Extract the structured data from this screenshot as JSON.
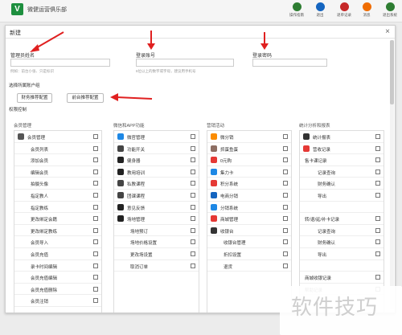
{
  "app": {
    "title": "微健运营俱乐部",
    "logo_text": "V"
  },
  "top_actions": [
    {
      "label": "操作指南",
      "color": "#2e7d32"
    },
    {
      "label": "退出",
      "color": "#1565c0"
    },
    {
      "label": "退单记录",
      "color": "#c62828"
    },
    {
      "label": "消息",
      "color": "#ef6c00"
    },
    {
      "label": "退出系统",
      "color": "#2e7d32"
    }
  ],
  "modal": {
    "title": "新建",
    "close_glyph": "×",
    "fields": {
      "name": {
        "label": "管理员姓名",
        "hint": "例如：前台小张、只是标识",
        "value": ""
      },
      "account": {
        "label": "登录账号",
        "hint": "6位以上的数字或字母，建议用手机号",
        "value": ""
      },
      "password": {
        "label": "登录密码",
        "value": ""
      }
    },
    "role_section_label": "选择所属账户组",
    "role_buttons": [
      "财务推荐配置",
      "前台推荐配置"
    ],
    "permission_label": "权限控制"
  },
  "columns": {
    "member": {
      "title": "会员管理",
      "rows": [
        {
          "label": "会员管理",
          "kind": "head",
          "icon": "#555"
        },
        {
          "label": "会员列表",
          "kind": "sub"
        },
        {
          "label": "添加会员",
          "kind": "sub"
        },
        {
          "label": "编辑会员",
          "kind": "sub"
        },
        {
          "label": "拍摄头像",
          "kind": "sub"
        },
        {
          "label": "指定教人",
          "kind": "sub"
        },
        {
          "label": "指定教练",
          "kind": "sub"
        },
        {
          "label": "更改绑定会籍",
          "kind": "sub"
        },
        {
          "label": "更改绑定教练",
          "kind": "sub"
        },
        {
          "label": "会员导入",
          "kind": "sub"
        },
        {
          "label": "会员充值",
          "kind": "sub"
        },
        {
          "label": "录卡时间编辑",
          "kind": "sub"
        },
        {
          "label": "会员充值编辑",
          "kind": "sub"
        },
        {
          "label": "会员充值删除",
          "kind": "sub"
        },
        {
          "label": "会员注销",
          "kind": "sub"
        }
      ]
    },
    "wechat": {
      "title": "微信和APP功能",
      "rows": [
        {
          "label": "微官管理",
          "kind": "head",
          "icon": "#1e88e5"
        },
        {
          "label": "功能开关",
          "kind": "head",
          "icon": "#444"
        },
        {
          "label": "健身器",
          "kind": "head",
          "icon": "#222"
        },
        {
          "label": "教用培训",
          "kind": "head",
          "icon": "#222"
        },
        {
          "label": "私教课程",
          "kind": "head",
          "icon": "#444"
        },
        {
          "label": "团课课程",
          "kind": "head",
          "icon": "#444"
        },
        {
          "label": "意见反馈",
          "kind": "head",
          "icon": "#222"
        },
        {
          "label": "场地管理",
          "kind": "head",
          "icon": "#222"
        },
        {
          "label": "场地预订",
          "kind": "sub"
        },
        {
          "label": "场地价格设置",
          "kind": "sub"
        },
        {
          "label": "更改场设置",
          "kind": "sub"
        },
        {
          "label": "取消订单",
          "kind": "sub"
        }
      ]
    },
    "marketing": {
      "title": "营销活动",
      "rows": [
        {
          "label": "微分销",
          "kind": "head",
          "icon": "#fb8c00"
        },
        {
          "label": "抓蛋鱼蛋",
          "kind": "head",
          "icon": "#8d6e63"
        },
        {
          "label": "0元购",
          "kind": "head",
          "icon": "#e53935"
        },
        {
          "label": "集力卡",
          "kind": "head",
          "icon": "#1e88e5"
        },
        {
          "label": "积分系统",
          "kind": "head",
          "icon": "#e53935"
        },
        {
          "label": "电商分销",
          "kind": "head",
          "icon": "#1565c0"
        },
        {
          "label": "分销系统",
          "kind": "head",
          "icon": "#1e88e5"
        },
        {
          "label": "商城管理",
          "kind": "head",
          "icon": "#e53935"
        },
        {
          "label": "收银台",
          "kind": "head",
          "icon": "#333"
        },
        {
          "label": "收银台管理",
          "kind": "sub"
        },
        {
          "label": "折扣设置",
          "kind": "sub"
        },
        {
          "label": "退货",
          "kind": "sub"
        }
      ]
    },
    "stats": {
      "title": "统计分析和报表",
      "rows": [
        {
          "label": "统计报表",
          "kind": "head",
          "icon": "#333"
        },
        {
          "label": "营收记录",
          "kind": "head",
          "icon": "#e53935"
        },
        {
          "label": "售卡课记录",
          "kind": "head2"
        },
        {
          "label": "记录查询",
          "kind": "sub2"
        },
        {
          "label": "财务确认",
          "kind": "sub2"
        },
        {
          "label": "导出",
          "kind": "sub2"
        },
        {
          "label": "",
          "kind": "blank"
        },
        {
          "label": "转/退/延/补卡记录",
          "kind": "head2"
        },
        {
          "label": "记录查询",
          "kind": "sub2"
        },
        {
          "label": "财务确认",
          "kind": "sub2"
        },
        {
          "label": "导出",
          "kind": "sub2"
        },
        {
          "label": "",
          "kind": "blank"
        },
        {
          "label": "商城收银记录",
          "kind": "head2"
        },
        {
          "label": "帮助记录",
          "kind": "head2"
        }
      ]
    }
  },
  "watermark": {
    "text": "软件技巧"
  }
}
